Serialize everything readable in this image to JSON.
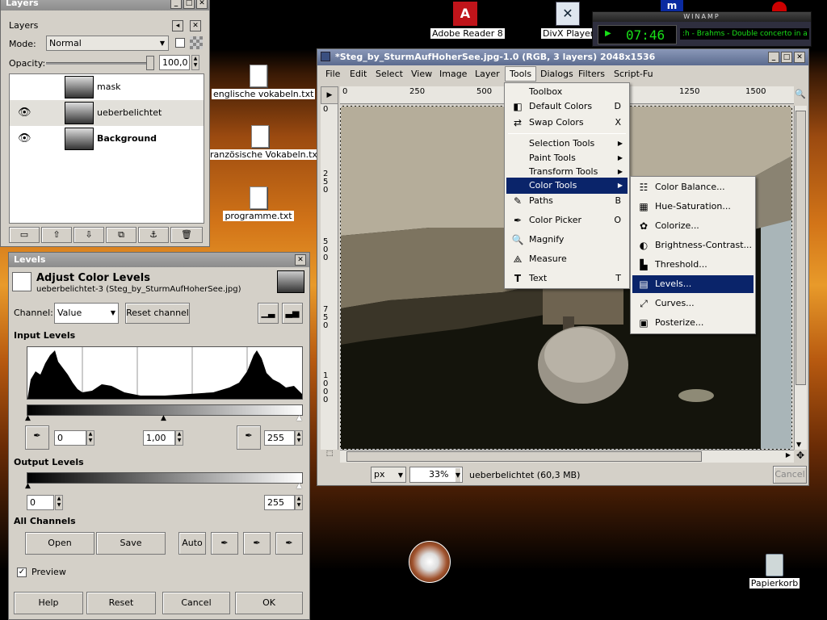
{
  "desktop": {
    "icons": [
      {
        "label": "Adobe Reader 8"
      },
      {
        "label": "DivX Player"
      },
      {
        "label": "englische vokabeln.txt"
      },
      {
        "label": "ranzösische Vokabeln.txt"
      },
      {
        "label": "programme.txt"
      },
      {
        "label": "Papierkorb"
      }
    ]
  },
  "winamp": {
    "title": "WINAMP",
    "time": "07:46",
    "track": ":h - Brahms - Double concerto in a"
  },
  "layers": {
    "title": "Layers",
    "header": "Layers",
    "mode_label": "Mode:",
    "mode_value": "Normal",
    "opacity_label": "Opacity:",
    "opacity_value": "100,0",
    "items": [
      {
        "name": "mask",
        "visible": false
      },
      {
        "name": "ueberbelichtet",
        "visible": true
      },
      {
        "name": "Background",
        "visible": true
      }
    ]
  },
  "levels": {
    "title": "Levels",
    "heading": "Adjust Color Levels",
    "subheading": "ueberbelichtet-3 (Steg_by_SturmAufHoherSee.jpg)",
    "channel_label": "Channel:",
    "channel_value": "Value",
    "reset_channel": "Reset channel",
    "input_levels": "Input Levels",
    "input_low": "0",
    "input_gamma": "1,00",
    "input_high": "255",
    "output_levels": "Output Levels",
    "output_low": "0",
    "output_high": "255",
    "all_channels": "All Channels",
    "open": "Open",
    "save": "Save",
    "auto": "Auto",
    "preview": "Preview",
    "preview_checked": true,
    "help": "Help",
    "reset": "Reset",
    "cancel": "Cancel",
    "ok": "OK"
  },
  "image": {
    "title": "*Steg_by_SturmAufHoherSee.jpg-1.0 (RGB, 3 layers) 2048x1536",
    "menu": [
      "File",
      "Edit",
      "Select",
      "View",
      "Image",
      "Layer",
      "Tools",
      "Dialogs",
      "Filters",
      "Script-Fu"
    ],
    "ruler_h": [
      "0",
      "250",
      "500",
      "1250",
      "1500"
    ],
    "ruler_v": [
      "0",
      "250",
      "500",
      "750",
      "1000"
    ],
    "unit": "px",
    "zoom": "33%",
    "status": "ueberbelichtet (60,3 MB)",
    "cancel": "Cancel"
  },
  "tools_menu": {
    "items": [
      {
        "label": "Toolbox",
        "shortcut": "",
        "icon": ""
      },
      {
        "label": "Default Colors",
        "shortcut": "D",
        "icon": "default-colors-icon"
      },
      {
        "label": "Swap Colors",
        "shortcut": "X",
        "icon": "swap-colors-icon"
      },
      {
        "label": "Selection Tools",
        "submenu": true
      },
      {
        "label": "Paint Tools",
        "submenu": true
      },
      {
        "label": "Transform Tools",
        "submenu": true
      },
      {
        "label": "Color Tools",
        "submenu": true,
        "selected": true
      },
      {
        "label": "Paths",
        "shortcut": "B",
        "icon": "paths-icon"
      },
      {
        "label": "Color Picker",
        "shortcut": "O",
        "icon": "color-picker-icon"
      },
      {
        "label": "Magnify",
        "shortcut": "",
        "icon": "magnify-icon"
      },
      {
        "label": "Measure",
        "shortcut": "",
        "icon": "measure-icon"
      },
      {
        "label": "Text",
        "shortcut": "T",
        "icon": "text-icon"
      }
    ]
  },
  "color_tools_menu": {
    "items": [
      {
        "label": "Color Balance..."
      },
      {
        "label": "Hue-Saturation..."
      },
      {
        "label": "Colorize..."
      },
      {
        "label": "Brightness-Contrast..."
      },
      {
        "label": "Threshold..."
      },
      {
        "label": "Levels...",
        "selected": true
      },
      {
        "label": "Curves..."
      },
      {
        "label": "Posterize..."
      }
    ]
  },
  "colors": {
    "menu_highlight": "#0a246a",
    "dialog_bg": "#d4d0c8"
  }
}
